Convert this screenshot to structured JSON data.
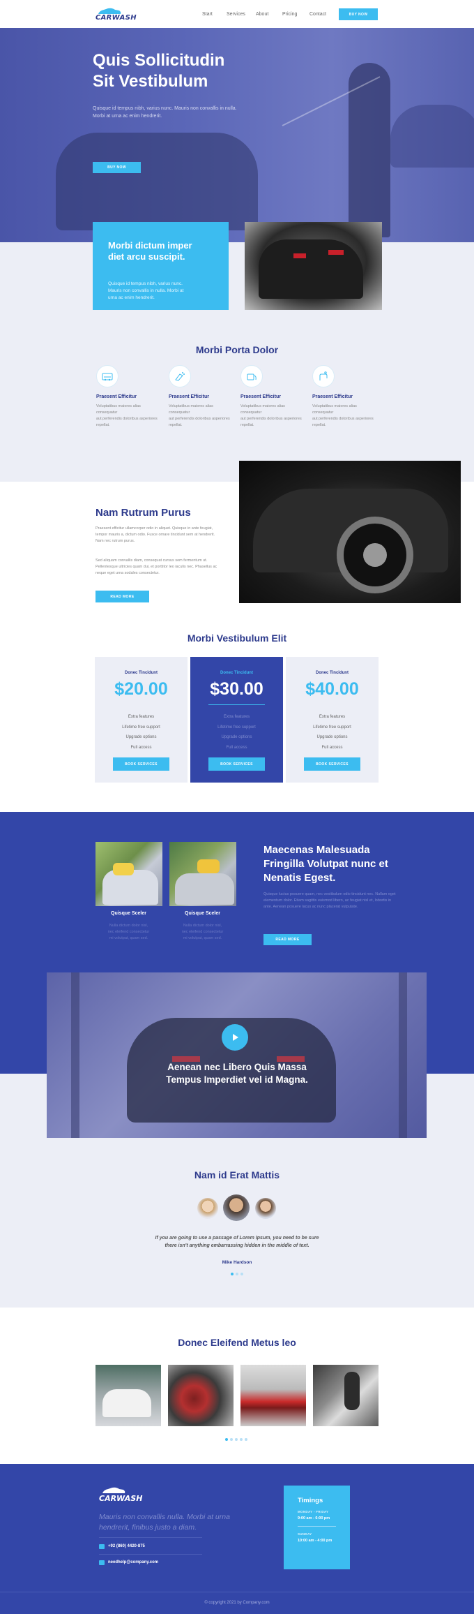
{
  "header": {
    "logo": "CARWASH",
    "nav": [
      "Start",
      "Services",
      "About",
      "Pricing",
      "Contact"
    ],
    "cta": "BUY NOW"
  },
  "hero": {
    "title_line1": "Quis Sollicitudin",
    "title_line2": "Sit Vestibulum",
    "text_line1": "Quisque id tempus nibh, varius nunc. Mauris non convallis in nulla.",
    "text_line2": "Morbi at urna ac enim hendrerit.",
    "button": "BUY NOW"
  },
  "intro_card": {
    "title_line1": "Morbi dictum imper",
    "title_line2": "diet arcu suscipit.",
    "text_line1": "Quisque id tempus nibh, varius nunc.",
    "text_line2": "Mauris non convallis in nulla. Morbi at",
    "text_line3": "urna ac enim hendrerit."
  },
  "services": {
    "title": "Morbi Porta Dolor",
    "items": [
      {
        "icon": "car-wash-icon",
        "title": "Praesent Efficitur",
        "line1": "Voluptatibus maiores alias consequatur",
        "line2": "aut perferendis doloribus asperiores repellat."
      },
      {
        "icon": "spray-icon",
        "title": "Praesent Efficitur",
        "line1": "Voluptatibus maiores alias consequatur",
        "line2": "aut perferendis doloribus asperiores repellat."
      },
      {
        "icon": "vacuum-icon",
        "title": "Praesent Efficitur",
        "line1": "Voluptatibus maiores alias consequatur",
        "line2": "aut perferendis doloribus asperiores repellat."
      },
      {
        "icon": "hand-wash-icon",
        "title": "Praesent Efficitur",
        "line1": "Voluptatibus maiores alias consequatur",
        "line2": "aut perferendis doloribus asperiores repellat."
      }
    ]
  },
  "about": {
    "title": "Nam Rutrum Purus",
    "p1": "Praesent efficitur ullamcorper odio in aliquet. Quisque in ante feugiat, tempor mauris a, dictum odio. Fusce ornare tincidunt sem at hendrerit. Nam nec rutrum purus.",
    "p2": "Sed aliquam convallis diam, consequat cursus sem fermentum ut. Pellentesque ultricies quam dui, et porttitor leo iaculis nec. Phasellus ac neque eget urna sodales consectetur.",
    "button": "READ MORE"
  },
  "pricing": {
    "title": "Morbi Vestibulum Elit",
    "plans": [
      {
        "tag": "Donec Tincidunt",
        "price": "$20.00",
        "features": [
          "Extra features",
          "Lifetime free support",
          "Upgrade options",
          "Full access"
        ],
        "button": "BOOK SERVICES"
      },
      {
        "tag": "Donec Tincidunt",
        "price": "$30.00",
        "features": [
          "Extra features",
          "Lifetime free support",
          "Upgrade options",
          "Full access"
        ],
        "button": "BOOK SERVICES"
      },
      {
        "tag": "Donec Tincidunt",
        "price": "$40.00",
        "features": [
          "Extra features",
          "Lifetime free support",
          "Upgrade options",
          "Full access"
        ],
        "button": "BOOK SERVICES"
      }
    ]
  },
  "feature": {
    "title": "Maecenas Malesuada Fringilla Volutpat nunc et Nenatis Egest.",
    "text": "Quisque luctus posuere quam, nec vestibulum odio tincidunt nec. Nullam eget elementum dolor. Etiam sagittis euismod libero, ac feugiat nisl et, lobortis in ante. Aenean posuere lacus ac nunc placerat vulputate.",
    "button": "READ MORE",
    "cards": [
      {
        "caption": "Quisque Sceler",
        "line1": "Nulla dictum dolor nisl,",
        "line2": "nec eleifend consectetur",
        "line3": "mi volutpat, quam sed."
      },
      {
        "caption": "Quisque Sceler",
        "line1": "Nulla dictum dolor nisl,",
        "line2": "nec eleifend consectetur",
        "line3": "mi volutpat, quam sed."
      }
    ]
  },
  "video": {
    "title_line1": "Aenean nec Libero Quis Massa",
    "title_line2": "Tempus Imperdiet vel id Magna."
  },
  "testimonials": {
    "title": "Nam id Erat Mattis",
    "quote_line1": "If you are going to use a passage of Lorem Ipsum, you need to be sure",
    "quote_line2": "there isn't anything embarrassing hidden in the middle of text.",
    "author": "Mike Hardson"
  },
  "gallery": {
    "title": "Donec Eleifend Metus leo"
  },
  "footer": {
    "logo": "CARWASH",
    "desc_line1": "Mauris non convallis nulla. Morbi at urna",
    "desc_line2": "hendrerit, finibus justo a diam.",
    "phone": "+92 (860) 4420-875",
    "email": "needhelp@company.com",
    "timings_title": "Timings",
    "monday_label": "MONDAY - FRIDAY",
    "monday_hours": "9:00 am - 6:00 pm",
    "sunday_label": "SUNDAY",
    "sunday_hours": "10:00 am - 4:00 pm",
    "copyright": "© copyright 2021 by Company.com"
  },
  "colors": {
    "brand_blue": "#3346a8",
    "accent": "#3cbcf0",
    "navy_text": "#2d3a8c",
    "light_bg": "#eceef6"
  }
}
